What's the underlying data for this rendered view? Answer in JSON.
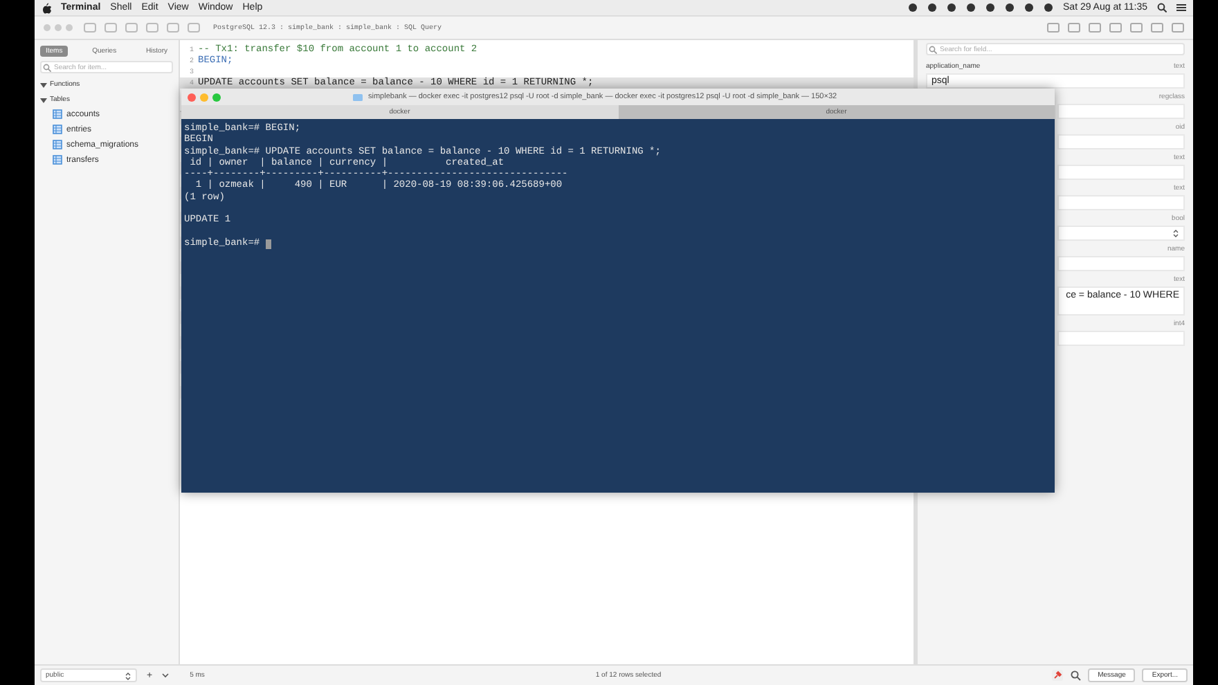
{
  "menu_bar": {
    "app": "Terminal",
    "items": [
      "Shell",
      "Edit",
      "View",
      "Window",
      "Help"
    ],
    "clock": "Sat 29 Aug at 11:35"
  },
  "toolbar": {
    "breadcrumb": "PostgreSQL 12.3 : simple_bank : simple_bank : SQL Query"
  },
  "sidebar": {
    "tabs": [
      {
        "label": "Items",
        "selected": true
      },
      {
        "label": "Queries",
        "selected": false
      },
      {
        "label": "History",
        "selected": false
      }
    ],
    "search": {
      "placeholder": "Search for item..."
    },
    "tree": [
      {
        "label": "Functions",
        "expanded": true
      },
      {
        "label": "Tables",
        "expanded": true,
        "children": [
          {
            "label": "accounts"
          },
          {
            "label": "entries"
          },
          {
            "label": "schema_migrations"
          },
          {
            "label": "transfers"
          }
        ]
      }
    ]
  },
  "editor": {
    "lines": [
      {
        "number": "1",
        "text": "-- Tx1: transfer $10 from account 1 to account 2",
        "kind": "comment",
        "selected": false
      },
      {
        "number": "2",
        "text": "BEGIN;",
        "kind": "keyword",
        "selected": false
      },
      {
        "number": "3",
        "selected": false
      },
      {
        "number": "4",
        "text": "UPDATE accounts SET balance = balance - 10 WHERE id = 1 RETURNING *;",
        "kind": "code",
        "selected": true
      }
    ]
  },
  "field_panel": {
    "search": {
      "placeholder": "Search for field..."
    },
    "fields": [
      {
        "label": "application_name",
        "type": "text",
        "value": "psql",
        "kind": "input"
      },
      {
        "type": "regclass",
        "kind": "input"
      },
      {
        "type": "oid",
        "kind": "input"
      },
      {
        "type": "text",
        "kind": "input"
      },
      {
        "type": "text",
        "kind": "input"
      },
      {
        "type": "bool",
        "kind": "select"
      },
      {
        "type": "name",
        "kind": "input"
      },
      {
        "type": "text",
        "value": "ce = balance - 10 WHERE",
        "kind": "textarea"
      },
      {
        "type": "int4",
        "kind": "input"
      }
    ]
  },
  "status_bar": {
    "schema": "public",
    "add": "+",
    "time": "5 ms",
    "selection": "1 of 12 rows selected",
    "buttons": [
      "Message",
      "Export..."
    ]
  },
  "terminal": {
    "title": "simplebank — docker exec -it postgres12 psql -U root -d simple_bank — docker exec -it postgres12 psql -U root -d simple_bank — 150×32",
    "tabs": [
      {
        "label": "docker",
        "selected": true
      },
      {
        "label": "docker",
        "selected": false
      }
    ],
    "blocks": [
      [
        "simple_bank=# BEGIN;",
        "BEGIN",
        "simple_bank=# UPDATE accounts SET balance = balance - 10 WHERE id = 1 RETURNING *;",
        " id | owner  | balance | currency |          created_at",
        "----+--------+---------+----------+-------------------------------",
        "  1 | ozmeak |     490 | EUR      | 2020-08-19 08:39:06.425689+00",
        "(1 row)"
      ],
      [
        "UPDATE 1"
      ]
    ],
    "prompt": "simple_bank=#"
  }
}
